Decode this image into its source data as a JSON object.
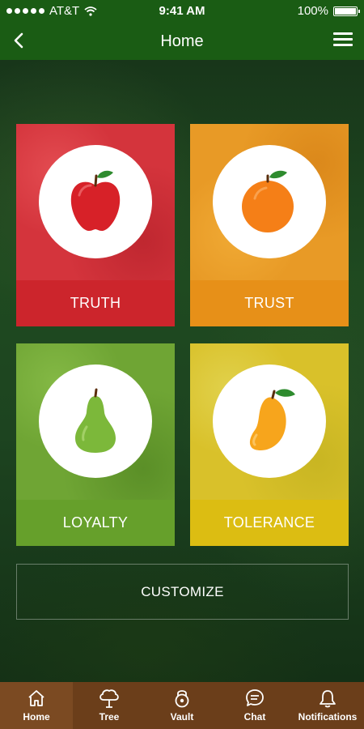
{
  "status_bar": {
    "carrier": "AT&T",
    "time": "9:41 AM",
    "battery": "100%"
  },
  "nav": {
    "title": "Home"
  },
  "tiles": [
    {
      "label": "TRUTH",
      "fruit": "apple-icon",
      "color": "#cc252c"
    },
    {
      "label": "TRUST",
      "fruit": "orange-icon",
      "color": "#e79018"
    },
    {
      "label": "LOYALTY",
      "fruit": "pear-icon",
      "color": "#66a02b"
    },
    {
      "label": "TOLERANCE",
      "fruit": "mango-icon",
      "color": "#dcbd12"
    }
  ],
  "customize_label": "CUSTOMIZE",
  "tabbar": {
    "items": [
      {
        "label": "Home",
        "icon": "home-icon"
      },
      {
        "label": "Tree",
        "icon": "tree-icon"
      },
      {
        "label": "Vault",
        "icon": "vault-icon"
      },
      {
        "label": "Chat",
        "icon": "chat-icon"
      },
      {
        "label": "Notifications",
        "icon": "bell-icon"
      }
    ],
    "color": "#6b3e1a"
  }
}
